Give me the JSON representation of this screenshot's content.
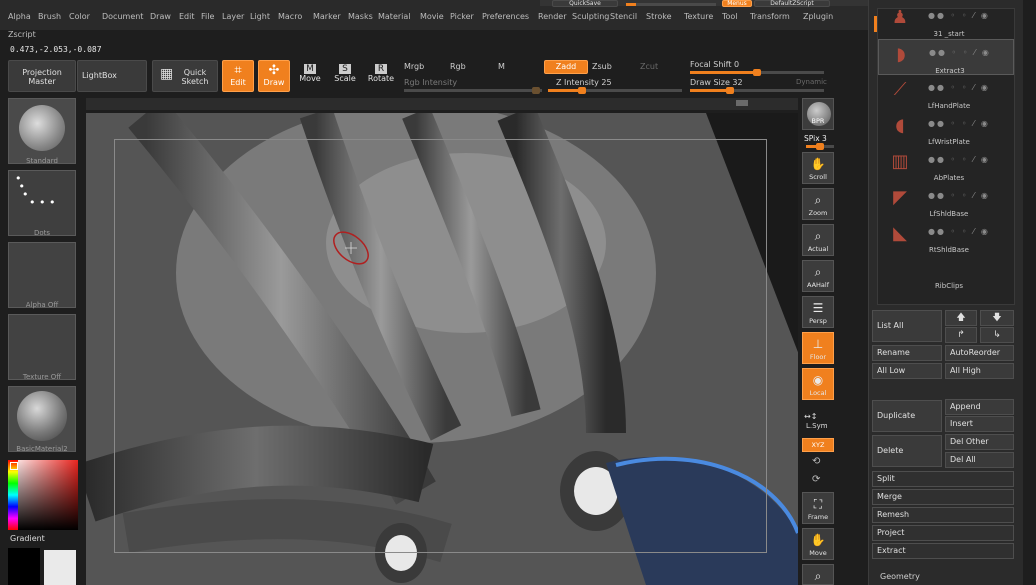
{
  "menu": [
    "Alpha",
    "Brush",
    "Color",
    "Document",
    "Draw",
    "Edit",
    "File",
    "Layer",
    "Light",
    "Macro",
    "Marker",
    "Masks",
    "Material",
    "Movie",
    "Picker",
    "Preferences",
    "Render",
    "Sculpting",
    "Stencil",
    "Stroke",
    "Texture",
    "Tool",
    "Transform",
    "Zplugin"
  ],
  "zscript": "Zscript",
  "coords": "0.473,-2.053,-0.087",
  "toolbar": {
    "projection_master": "Projection\nMaster",
    "lightbox": "LightBox",
    "quick_sketch": "Quick\nSketch",
    "edit": "Edit",
    "draw": "Draw",
    "move": "Move",
    "scale": "Scale",
    "rotate": "Rotate",
    "mrgb": "Mrgb",
    "rgb": "Rgb",
    "m": "M",
    "rgb_intensity": "Rgb Intensity",
    "zadd": "Zadd",
    "zsub": "Zsub",
    "zcut": "Zcut",
    "z_intensity": "Z Intensity 25",
    "focal_shift": "Focal Shift 0",
    "draw_size": "Draw Size 32",
    "dynamic": "Dynamic",
    "quicksave": "QuickSave",
    "menus": "Menus",
    "default_zscript": "DefaultZScript"
  },
  "shelf": {
    "brush": "Standard",
    "stroke": "Dots",
    "alpha": "Alpha Off",
    "texture": "Texture Off",
    "material": "BasicMaterial2",
    "gradient": "Gradient"
  },
  "right_tools": {
    "bpr": "BPR",
    "spix": "SPix 3",
    "scroll": "Scroll",
    "zoom": "Zoom",
    "actual": "Actual",
    "aahalf": "AAHalf",
    "persp": "Persp",
    "floor": "Floor",
    "local": "Local",
    "lsym": "L.Sym",
    "xyz": "XYZ",
    "frame": "Frame",
    "move": "Move"
  },
  "subtools": [
    {
      "name": "31 _start"
    },
    {
      "name": "Extract3"
    },
    {
      "name": "LfHandPlate"
    },
    {
      "name": "LfWristPlate"
    },
    {
      "name": "AbPlates"
    },
    {
      "name": "LfShldBase"
    },
    {
      "name": "RtShldBase"
    },
    {
      "name": "RibClips"
    }
  ],
  "panel": {
    "list_all": "List All",
    "rename": "Rename",
    "autoreorder": "AutoReorder",
    "all_low": "All Low",
    "all_high": "All High",
    "duplicate": "Duplicate",
    "append": "Append",
    "insert": "Insert",
    "delete": "Delete",
    "del_other": "Del Other",
    "del_all": "Del All",
    "split": "Split",
    "merge": "Merge",
    "remesh": "Remesh",
    "project": "Project",
    "extract": "Extract",
    "geometry": "Geometry"
  },
  "colors": {
    "accent": "#f0801e",
    "panel": "#2b2b2b"
  },
  "sliders": {
    "z_intensity_fraction": 0.25,
    "focal_shift_fraction": 0.5,
    "draw_size_fraction": 0.3
  }
}
